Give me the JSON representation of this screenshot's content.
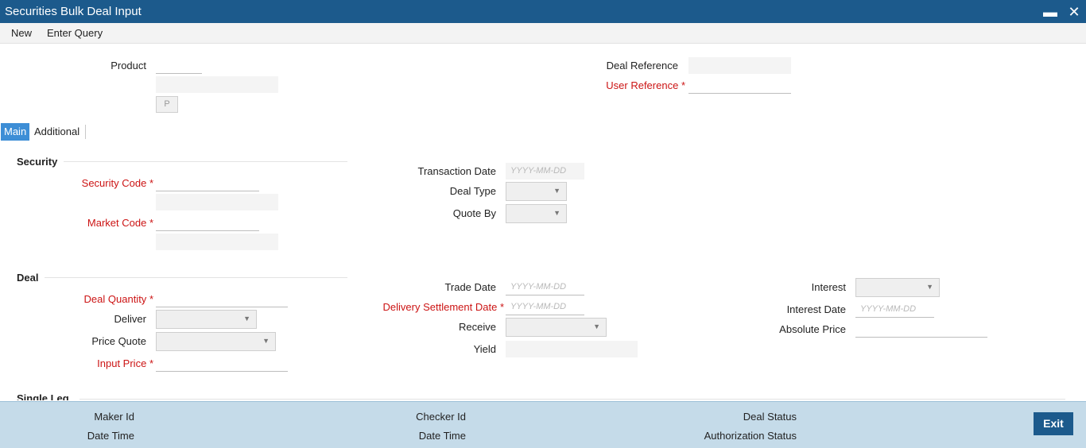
{
  "window": {
    "title": "Securities Bulk Deal Input",
    "minimize_glyph": "▬",
    "close_glyph": "✕"
  },
  "menu": {
    "new": "New",
    "enter_query": "Enter Query"
  },
  "header": {
    "product_label": "Product",
    "p_button": "P",
    "deal_reference_label": "Deal Reference",
    "user_reference_label": "User Reference"
  },
  "tabs": {
    "main": "Main",
    "additional": "Additional"
  },
  "security": {
    "heading": "Security",
    "security_code_label": "Security Code",
    "market_code_label": "Market Code",
    "transaction_date_label": "Transaction Date",
    "transaction_date_placeholder": "YYYY-MM-DD",
    "deal_type_label": "Deal Type",
    "quote_by_label": "Quote By"
  },
  "deal": {
    "heading": "Deal",
    "deal_quantity_label": "Deal Quantity",
    "deliver_label": "Deliver",
    "price_quote_label": "Price Quote",
    "input_price_label": "Input Price",
    "trade_date_label": "Trade Date",
    "trade_date_placeholder": "YYYY-MM-DD",
    "delivery_settlement_date_label": "Delivery Settlement Date",
    "delivery_settlement_date_placeholder": "YYYY-MM-DD",
    "receive_label": "Receive",
    "yield_label": "Yield",
    "interest_label": "Interest",
    "interest_date_label": "Interest Date",
    "interest_date_placeholder": "YYYY-MM-DD",
    "absolute_price_label": "Absolute Price"
  },
  "single_leg": {
    "heading": "Single Leg"
  },
  "required_marker": "*",
  "dropdown_arrow": "▼",
  "footer": {
    "maker_id": "Maker Id",
    "maker_date_time": "Date Time",
    "checker_id": "Checker Id",
    "checker_date_time": "Date Time",
    "deal_status": "Deal Status",
    "authorization_status": "Authorization Status",
    "exit": "Exit"
  },
  "colors": {
    "title_bar": "#1c5a8c",
    "required": "#cc1414",
    "active_tab": "#3d8ed6",
    "footer": "#c5dbe9"
  }
}
